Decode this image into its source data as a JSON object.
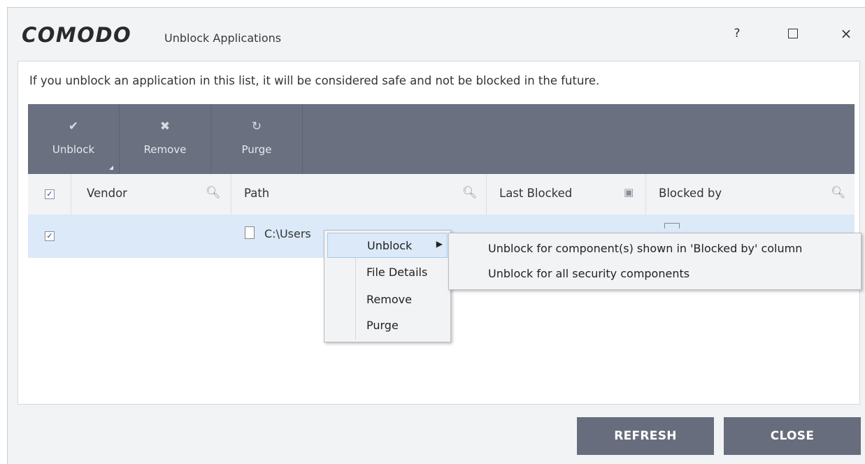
{
  "window": {
    "logo_text": "COMODO",
    "title": "Unblock Applications",
    "help_label": "?",
    "close_label": "×"
  },
  "info_text": "If you unblock an application in this list, it will be considered safe and not be blocked in the future.",
  "toolbar": {
    "unblock_label": "Unblock",
    "remove_label": "Remove",
    "purge_label": "Purge"
  },
  "table": {
    "headers": [
      "Vendor",
      "Path",
      "Last Blocked",
      "Blocked by"
    ],
    "rows": [
      {
        "checked": true,
        "vendor": "",
        "path": "C:\\Users"
      }
    ]
  },
  "context_menu": {
    "items": [
      "Unblock",
      "File Details",
      "Remove",
      "Purge"
    ]
  },
  "submenu": {
    "items": [
      "Unblock for component(s) shown in 'Blocked by' column",
      "Unblock for all security components"
    ]
  },
  "buttons": {
    "refresh": "REFRESH",
    "close": "CLOSE"
  },
  "colors": {
    "toolbar": "#6a7080",
    "selected_row": "#dbe9f8",
    "button": "#676d7c"
  }
}
